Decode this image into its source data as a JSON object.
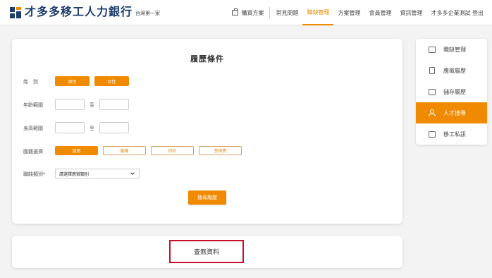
{
  "brand": {
    "name": "才多多移工人力銀行",
    "tagline": "台灣第一家"
  },
  "nav": {
    "items": [
      "購買方案",
      "常見問題",
      "職缺管理",
      "方案管理",
      "會員管理",
      "資訊管理",
      "才多多企業測試 登出"
    ],
    "active": "職缺管理"
  },
  "form": {
    "title": "履歷條件",
    "gender": {
      "label": "姓　別",
      "options": [
        "男性",
        "女性"
      ]
    },
    "age": {
      "label": "年齡範圍",
      "from": "",
      "to_text": "至",
      "to": ""
    },
    "height": {
      "label": "身高範圍",
      "from": "",
      "to_text": "至",
      "to": ""
    },
    "nationality": {
      "label": "國籍選擇",
      "options": [
        "越南",
        "泰國",
        "印尼",
        "菲律賓"
      ],
      "selected": "越南"
    },
    "job_category": {
      "label": "職缺類別*",
      "value": "請選擇應徵類別"
    },
    "search_button": "搜尋履歷"
  },
  "result": {
    "message": "查無資料"
  },
  "side_menu": {
    "items": [
      "職缺管理",
      "應徵履歷",
      "儲存履歷",
      "人才搜尋",
      "移工私訊"
    ],
    "active": "人才搜尋"
  },
  "colors": {
    "accent": "#f08a00",
    "brand": "#1d3d6b",
    "highlight_border": "#c8102e"
  }
}
